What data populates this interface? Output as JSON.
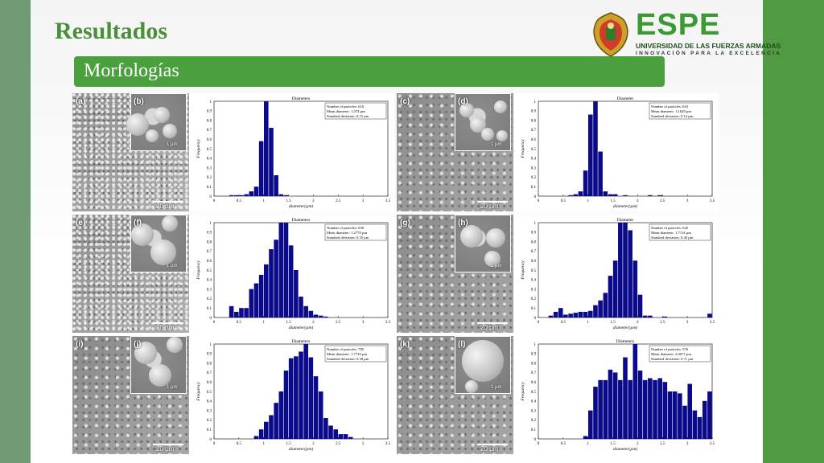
{
  "header": {
    "title": "Resultados",
    "subtitle": "Morfologías"
  },
  "logo": {
    "name": "ESPE",
    "university": "UNIVERSIDAD DE LAS FUERZAS ARMADAS",
    "tagline": "INNOVACIÓN PARA LA EXCELENCIA"
  },
  "colors": {
    "accent": "#4aa03d",
    "title": "#4a8f3a",
    "bars": "#0a0a8a"
  },
  "panels": [
    {
      "sem_label": "(a)",
      "inset_label": "(b)",
      "scale": "20 µm",
      "inset_scale": "1 µm"
    },
    {
      "sem_label": "(c)",
      "inset_label": "(d)",
      "scale": "20 µm",
      "inset_scale": "1 µm"
    },
    {
      "sem_label": "(e)",
      "inset_label": "(f)",
      "scale": "20 µm",
      "inset_scale": "1 µm"
    },
    {
      "sem_label": "(g)",
      "inset_label": "(h)",
      "scale": "20 µm",
      "inset_scale": "1 µm"
    },
    {
      "sem_label": "(i)",
      "inset_label": "(j)",
      "scale": "20 µm",
      "inset_scale": "1 µm"
    },
    {
      "sem_label": "(k)",
      "inset_label": "(l)",
      "scale": "20 µm",
      "inset_scale": "1 µm"
    }
  ],
  "chart_data": [
    {
      "type": "bar",
      "title": "Diameters",
      "xlabel": "diameter(µm)",
      "ylabel": "Frequency",
      "xlim": [
        0,
        3.5
      ],
      "ylim": [
        0,
        1
      ],
      "xticks": [
        "0",
        "0.5",
        "1",
        "1.5",
        "2",
        "2.5",
        "3",
        "3.5"
      ],
      "yticks": [
        "0",
        "0.1",
        "0.2",
        "0.3",
        "0.4",
        "0.5",
        "0.6",
        "0.7",
        "0.8",
        "0.9",
        "1"
      ],
      "stats": [
        "Number of particles: 616",
        "Mean diameter: 1.074 µm",
        "Standard deviation: 0.15 µm"
      ],
      "bin_width": 0.1,
      "x": [
        0.35,
        0.45,
        0.55,
        0.65,
        0.75,
        0.85,
        0.95,
        1.05,
        1.15,
        1.25,
        1.35,
        1.45
      ],
      "values": [
        0.01,
        0.01,
        0.01,
        0.02,
        0.05,
        0.1,
        0.58,
        1.0,
        0.72,
        0.22,
        0.02,
        0.01
      ]
    },
    {
      "type": "bar",
      "title": "Diameter",
      "xlabel": "diameter(µm)",
      "ylabel": "Frequency",
      "xlim": [
        0,
        3.5
      ],
      "ylim": [
        0,
        1
      ],
      "xticks": [
        "0",
        "0.5",
        "1",
        "1.5",
        "2",
        "2.5",
        "3",
        "3.5"
      ],
      "yticks": [
        "0",
        "0.1",
        "0.2",
        "0.3",
        "0.4",
        "0.5",
        "0.6",
        "0.7",
        "0.8",
        "0.9",
        "1"
      ],
      "stats": [
        "Number of particles: 632",
        "Mean diameter: 1.1620 µm",
        "Standard deviation: 0.14 µm"
      ],
      "bin_width": 0.1,
      "x": [
        0.65,
        0.75,
        0.85,
        0.95,
        1.05,
        1.15,
        1.25,
        1.35,
        1.45,
        1.55,
        1.75,
        2.25,
        2.45
      ],
      "values": [
        0.01,
        0.02,
        0.05,
        0.27,
        0.86,
        1.0,
        0.47,
        0.05,
        0.02,
        0.02,
        0.01,
        0.01,
        0.01
      ]
    },
    {
      "type": "bar",
      "title": "Diameters",
      "xlabel": "diameter(µm)",
      "ylabel": "Frequency",
      "xlim": [
        0,
        3.5
      ],
      "ylim": [
        0,
        1
      ],
      "xticks": [
        "0",
        "0.5",
        "1",
        "1.5",
        "2",
        "2.5",
        "3",
        "3.5"
      ],
      "yticks": [
        "0",
        "0.1",
        "0.2",
        "0.3",
        "0.4",
        "0.5",
        "0.6",
        "0.7",
        "0.8",
        "0.9",
        "1"
      ],
      "stats": [
        "Number of particles: 630",
        "Mean diameter: 1.2770 µm",
        "Standard deviation: 0.35 µm"
      ],
      "bin_width": 0.1,
      "x": [
        0.35,
        0.45,
        0.55,
        0.65,
        0.75,
        0.85,
        0.95,
        1.05,
        1.15,
        1.25,
        1.35,
        1.45,
        1.55,
        1.65,
        1.75,
        1.85,
        1.95,
        2.05,
        2.15,
        2.25
      ],
      "values": [
        0.12,
        0.06,
        0.1,
        0.1,
        0.3,
        0.36,
        0.45,
        0.56,
        0.72,
        0.82,
        1.0,
        1.0,
        0.76,
        0.5,
        0.22,
        0.12,
        0.07,
        0.03,
        0.02,
        0.01
      ]
    },
    {
      "type": "bar",
      "title": "Diameter",
      "xlabel": "diameter(µm)",
      "ylabel": "Frequency",
      "xlim": [
        0,
        3.5
      ],
      "ylim": [
        0,
        1
      ],
      "xticks": [
        "0",
        "0.5",
        "1",
        "1.5",
        "2",
        "2.5",
        "3",
        "3.5"
      ],
      "yticks": [
        "0",
        "0.1",
        "0.2",
        "0.3",
        "0.4",
        "0.5",
        "0.6",
        "0.7",
        "0.8",
        "0.9",
        "1"
      ],
      "stats": [
        "Number of particles: 626",
        "Mean diameter: 1.7114 µm",
        "Standard deviation: 0.40 µm"
      ],
      "bin_width": 0.1,
      "x": [
        0.25,
        0.35,
        0.45,
        0.55,
        0.65,
        0.75,
        0.85,
        0.95,
        1.05,
        1.15,
        1.25,
        1.35,
        1.45,
        1.55,
        1.65,
        1.75,
        1.85,
        1.95,
        2.05,
        2.15,
        2.25,
        2.55,
        3.45
      ],
      "values": [
        0.02,
        0.06,
        0.1,
        0.03,
        0.04,
        0.05,
        0.06,
        0.06,
        0.07,
        0.13,
        0.18,
        0.26,
        0.44,
        0.6,
        1.0,
        1.0,
        0.92,
        0.6,
        0.24,
        0.02,
        0.02,
        0.01,
        0.04
      ]
    },
    {
      "type": "bar",
      "title": "Diameters",
      "xlabel": "diameter(µm)",
      "ylabel": "Frequency",
      "xlim": [
        0,
        3.5
      ],
      "ylim": [
        0,
        1
      ],
      "xticks": [
        "0",
        "0.5",
        "1",
        "1.5",
        "2",
        "2.5",
        "3",
        "3.5"
      ],
      "yticks": [
        "0",
        "0.1",
        "0.2",
        "0.3",
        "0.4",
        "0.5",
        "0.6",
        "0.7",
        "0.8",
        "0.9",
        "1"
      ],
      "stats": [
        "Number of particles: 785",
        "Mean diameter: 1.7710 µm",
        "Standard deviation: 0.38 µm"
      ],
      "bin_width": 0.1,
      "x": [
        0.85,
        0.95,
        1.05,
        1.15,
        1.25,
        1.35,
        1.45,
        1.55,
        1.65,
        1.75,
        1.85,
        1.95,
        2.05,
        2.15,
        2.25,
        2.35,
        2.45,
        2.55,
        2.65,
        2.75
      ],
      "values": [
        0.03,
        0.1,
        0.18,
        0.25,
        0.38,
        0.5,
        0.72,
        0.85,
        0.87,
        0.92,
        1.0,
        0.86,
        0.66,
        0.5,
        0.22,
        0.14,
        0.1,
        0.05,
        0.05,
        0.02
      ]
    },
    {
      "type": "bar",
      "title": "Diameters",
      "xlabel": "diameter(µm)",
      "ylabel": "Frequency",
      "xlim": [
        0,
        3.5
      ],
      "ylim": [
        0,
        1
      ],
      "xticks": [
        "0",
        "0.5",
        "1",
        "1.5",
        "2",
        "2.5",
        "3",
        "3.5"
      ],
      "yticks": [
        "0",
        "0.1",
        "0.2",
        "0.3",
        "0.4",
        "0.5",
        "0.6",
        "0.7",
        "0.8",
        "0.9",
        "1"
      ],
      "stats": [
        "Number of particles: 576",
        "Mean diameter: 2.0071 µm",
        "Standard deviation: 0.71 µm"
      ],
      "bin_width": 0.1,
      "x": [
        0.95,
        1.05,
        1.15,
        1.25,
        1.35,
        1.45,
        1.55,
        1.65,
        1.75,
        1.85,
        1.95,
        2.05,
        2.15,
        2.25,
        2.35,
        2.45,
        2.55,
        2.65,
        2.75,
        2.85,
        2.95,
        3.05,
        3.15,
        3.25,
        3.35,
        3.45
      ],
      "values": [
        0.03,
        0.3,
        0.55,
        0.62,
        0.62,
        0.73,
        0.7,
        0.62,
        0.86,
        0.62,
        1.0,
        0.72,
        0.62,
        0.64,
        0.62,
        0.64,
        0.6,
        0.5,
        0.5,
        0.48,
        0.35,
        0.58,
        0.3,
        0.23,
        0.4,
        0.5
      ]
    }
  ]
}
